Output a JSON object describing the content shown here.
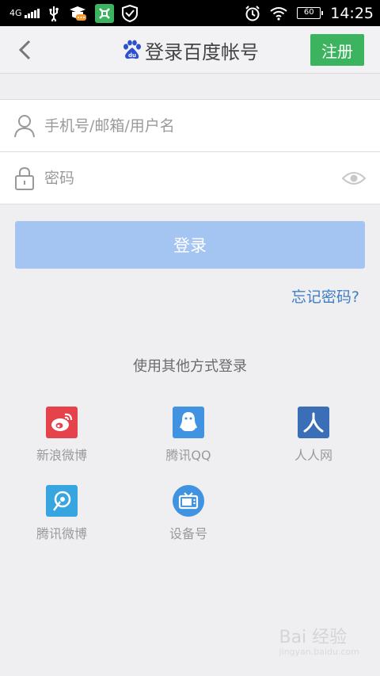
{
  "status_bar": {
    "network": "4G",
    "battery": "60",
    "time": "14:25"
  },
  "header": {
    "title": "登录百度帐号",
    "register_label": "注册"
  },
  "form": {
    "username_placeholder": "手机号/邮箱/用户名",
    "password_placeholder": "密码"
  },
  "login_label": "登录",
  "forgot_label": "忘记密码?",
  "other_login": {
    "title": "使用其他方式登录",
    "options": [
      {
        "label": "新浪微博",
        "color": "#e6424b",
        "icon": "weibo-icon"
      },
      {
        "label": "腾讯QQ",
        "color": "#3f93e0",
        "icon": "qq-icon"
      },
      {
        "label": "人人网",
        "color": "#3a6fb8",
        "icon": "renren-icon"
      },
      {
        "label": "腾讯微博",
        "color": "#37a6e0",
        "icon": "tencent-weibo-icon"
      },
      {
        "label": "设备号",
        "color": "#3f93e0",
        "icon": "tv-icon"
      }
    ]
  },
  "watermark": {
    "brand": "Bai 经验",
    "url": "jingyan.baidu.com"
  },
  "colors": {
    "accent_green": "#3cb35e",
    "login_button": "#a4c4f2",
    "link_blue": "#3e7fc5",
    "background": "#efeff1"
  }
}
